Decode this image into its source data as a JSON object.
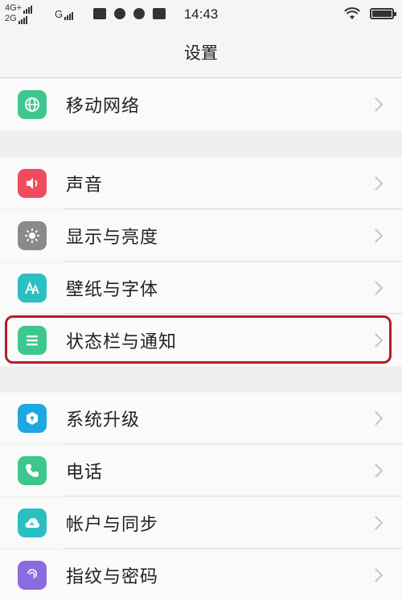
{
  "status_bar": {
    "net_line1": "4G+",
    "net_line2": "2G",
    "net_g": "G",
    "time": "14:43"
  },
  "header": {
    "title": "设置"
  },
  "settings": {
    "items": [
      {
        "label": "移动网络",
        "icon": "globe-icon",
        "color": "#3dc78f"
      },
      {
        "label": "声音",
        "icon": "speaker-icon",
        "color": "#f24b5e"
      },
      {
        "label": "显示与亮度",
        "icon": "brightness-icon",
        "color": "#8a8a8a"
      },
      {
        "label": "壁纸与字体",
        "icon": "font-icon",
        "color": "#2bbfc2"
      },
      {
        "label": "状态栏与通知",
        "icon": "list-icon",
        "color": "#3dc78f"
      },
      {
        "label": "系统升级",
        "icon": "upgrade-icon",
        "color": "#1ea8e0"
      },
      {
        "label": "电话",
        "icon": "phone-icon",
        "color": "#3dc78f"
      },
      {
        "label": "帐户与同步",
        "icon": "cloud-icon",
        "color": "#2bbfc2"
      },
      {
        "label": "指纹与密码",
        "icon": "fingerprint-icon",
        "color": "#8c6be0"
      }
    ]
  },
  "highlight_color": "#b51e25"
}
